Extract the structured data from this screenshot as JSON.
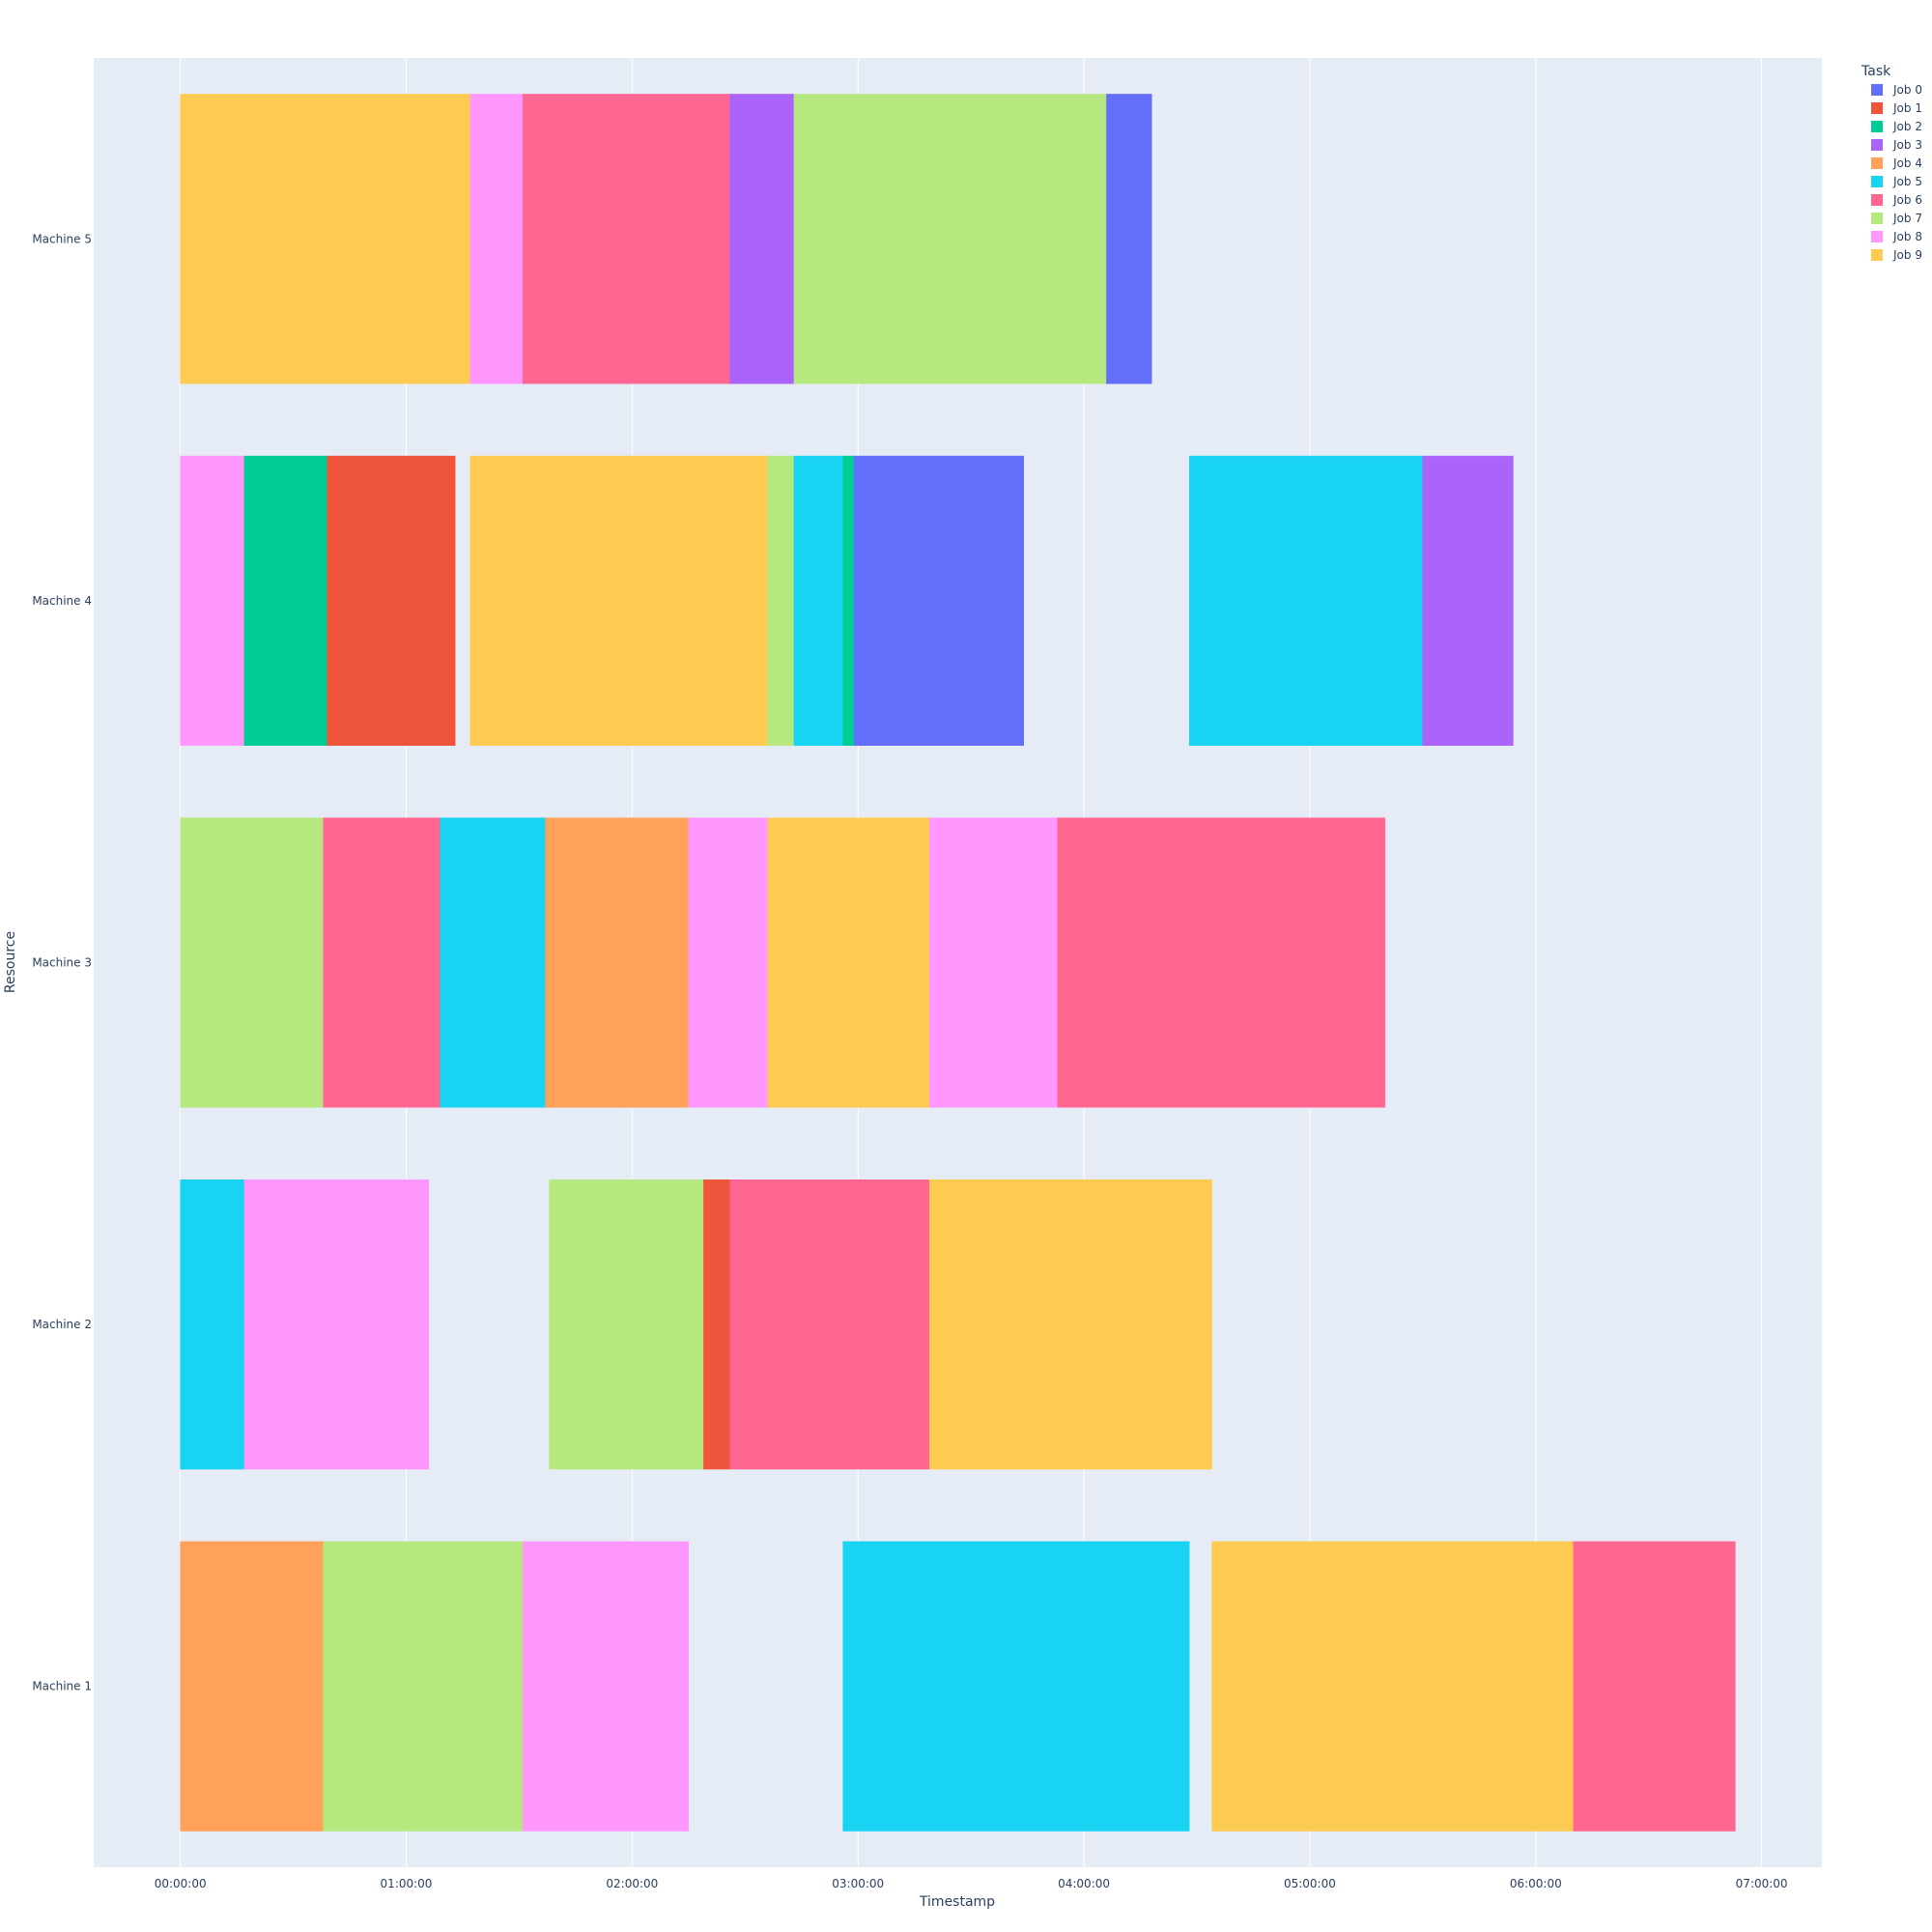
{
  "chart_data": {
    "type": "bar",
    "orientation": "horizontal-gantt",
    "xlabel": "Timestamp",
    "ylabel": "Resource",
    "x_tick_labels": [
      "00:00:00",
      "01:00:00",
      "02:00:00",
      "03:00:00",
      "04:00:00",
      "05:00:00",
      "06:00:00",
      "07:00:00"
    ],
    "x_range_minutes": [
      -23,
      436
    ],
    "resources": [
      "Machine 5",
      "Machine 4",
      "Machine 3",
      "Machine 2",
      "Machine 1"
    ],
    "grid": "on",
    "legend": {
      "title": "Task",
      "placement": "top-right",
      "entries": [
        {
          "name": "Job 0",
          "color": "#636EFA"
        },
        {
          "name": "Job 1",
          "color": "#EF553B"
        },
        {
          "name": "Job 2",
          "color": "#00CC96"
        },
        {
          "name": "Job 3",
          "color": "#AB63FA"
        },
        {
          "name": "Job 4",
          "color": "#FFA15A"
        },
        {
          "name": "Job 5",
          "color": "#19D3F3"
        },
        {
          "name": "Job 6",
          "color": "#FF6692"
        },
        {
          "name": "Job 7",
          "color": "#B6E880"
        },
        {
          "name": "Job 8",
          "color": "#FF97FF"
        },
        {
          "name": "Job 9",
          "color": "#FECB52"
        }
      ]
    },
    "tasks": [
      {
        "resource": "Machine 5",
        "job": "Job 9",
        "start": 0,
        "end": 77
      },
      {
        "resource": "Machine 5",
        "job": "Job 8",
        "start": 77,
        "end": 91
      },
      {
        "resource": "Machine 5",
        "job": "Job 6",
        "start": 91,
        "end": 146
      },
      {
        "resource": "Machine 5",
        "job": "Job 3",
        "start": 146,
        "end": 163
      },
      {
        "resource": "Machine 5",
        "job": "Job 7",
        "start": 163,
        "end": 246
      },
      {
        "resource": "Machine 5",
        "job": "Job 0",
        "start": 246,
        "end": 258
      },
      {
        "resource": "Machine 4",
        "job": "Job 8",
        "start": 0,
        "end": 17
      },
      {
        "resource": "Machine 4",
        "job": "Job 2",
        "start": 17,
        "end": 39
      },
      {
        "resource": "Machine 4",
        "job": "Job 1",
        "start": 39,
        "end": 73
      },
      {
        "resource": "Machine 4",
        "job": "Job 9",
        "start": 77,
        "end": 156
      },
      {
        "resource": "Machine 4",
        "job": "Job 7",
        "start": 156,
        "end": 163
      },
      {
        "resource": "Machine 4",
        "job": "Job 5",
        "start": 163,
        "end": 176
      },
      {
        "resource": "Machine 4",
        "job": "Job 2",
        "start": 176,
        "end": 179
      },
      {
        "resource": "Machine 4",
        "job": "Job 0",
        "start": 179,
        "end": 224
      },
      {
        "resource": "Machine 4",
        "job": "Job 5",
        "start": 268,
        "end": 330
      },
      {
        "resource": "Machine 4",
        "job": "Job 3",
        "start": 330,
        "end": 354
      },
      {
        "resource": "Machine 3",
        "job": "Job 7",
        "start": 0,
        "end": 38
      },
      {
        "resource": "Machine 3",
        "job": "Job 6",
        "start": 38,
        "end": 69
      },
      {
        "resource": "Machine 3",
        "job": "Job 5",
        "start": 69,
        "end": 97
      },
      {
        "resource": "Machine 3",
        "job": "Job 4",
        "start": 97,
        "end": 117
      },
      {
        "resource": "Machine 3",
        "job": "Job 4",
        "start": 117,
        "end": 135
      },
      {
        "resource": "Machine 3",
        "job": "Job 8",
        "start": 135,
        "end": 156
      },
      {
        "resource": "Machine 3",
        "job": "Job 9",
        "start": 156,
        "end": 199
      },
      {
        "resource": "Machine 3",
        "job": "Job 8",
        "start": 199,
        "end": 233
      },
      {
        "resource": "Machine 3",
        "job": "Job 6",
        "start": 233,
        "end": 320
      },
      {
        "resource": "Machine 2",
        "job": "Job 5",
        "start": 0,
        "end": 17
      },
      {
        "resource": "Machine 2",
        "job": "Job 8",
        "start": 17,
        "end": 66
      },
      {
        "resource": "Machine 2",
        "job": "Job 7",
        "start": 98,
        "end": 139
      },
      {
        "resource": "Machine 2",
        "job": "Job 1",
        "start": 139,
        "end": 146
      },
      {
        "resource": "Machine 2",
        "job": "Job 6",
        "start": 146,
        "end": 199
      },
      {
        "resource": "Machine 2",
        "job": "Job 9",
        "start": 199,
        "end": 274
      },
      {
        "resource": "Machine 1",
        "job": "Job 4",
        "start": 0,
        "end": 38
      },
      {
        "resource": "Machine 1",
        "job": "Job 7",
        "start": 38,
        "end": 91
      },
      {
        "resource": "Machine 1",
        "job": "Job 8",
        "start": 91,
        "end": 135
      },
      {
        "resource": "Machine 1",
        "job": "Job 5",
        "start": 176,
        "end": 268
      },
      {
        "resource": "Machine 1",
        "job": "Job 9",
        "start": 274,
        "end": 370
      },
      {
        "resource": "Machine 1",
        "job": "Job 6",
        "start": 370,
        "end": 413
      }
    ]
  }
}
